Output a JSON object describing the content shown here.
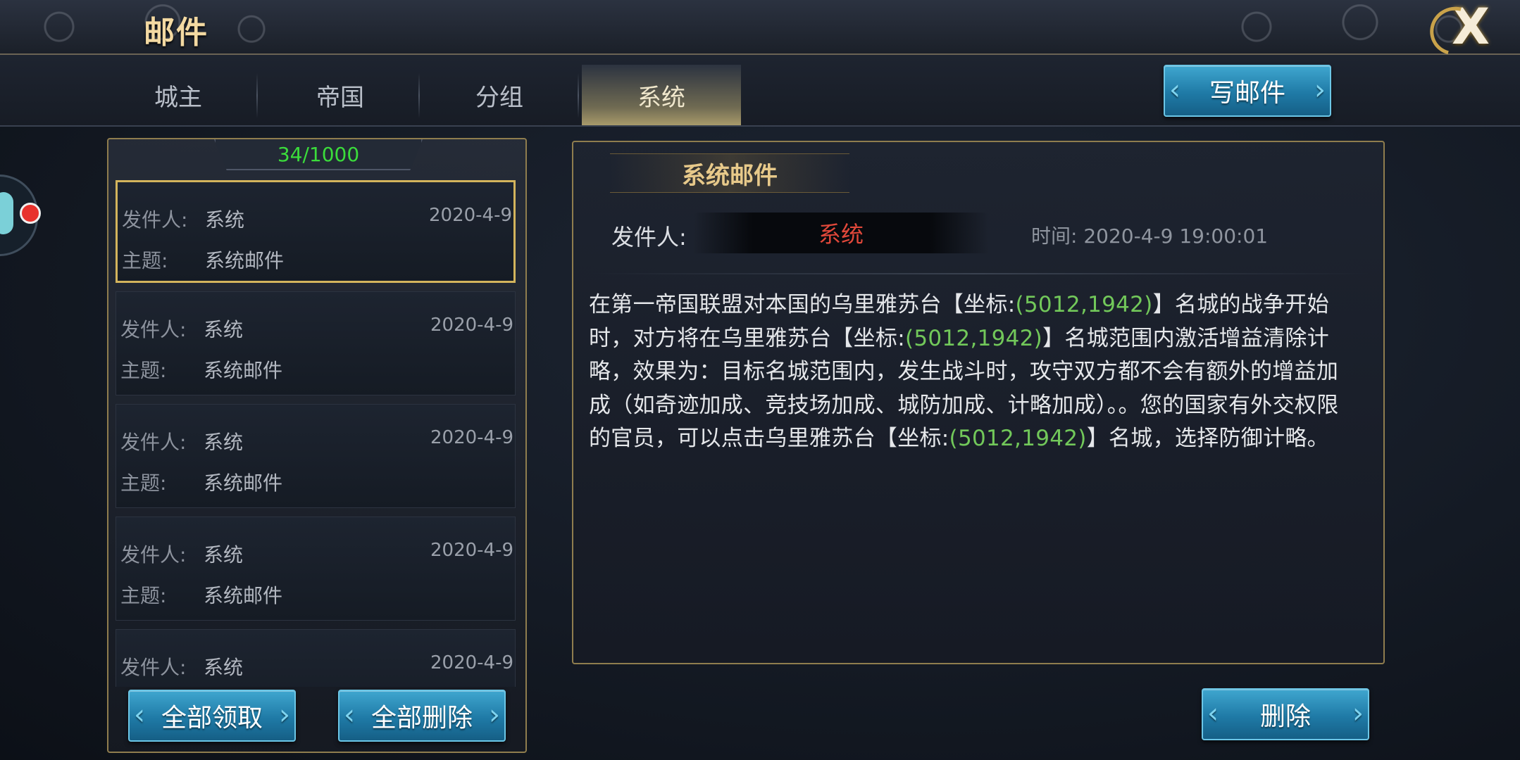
{
  "window": {
    "title": "邮件",
    "close_label": "X"
  },
  "tabs": [
    {
      "label": "城主",
      "active": false
    },
    {
      "label": "帝国",
      "active": false
    },
    {
      "label": "分组",
      "active": false
    },
    {
      "label": "系统",
      "active": true
    }
  ],
  "compose_button": "写邮件",
  "mail_list": {
    "count": "34/1000",
    "sender_label": "发件人:",
    "subject_label": "主题:",
    "items": [
      {
        "sender": "系统",
        "subject": "系统邮件",
        "date": "2020-4-9",
        "selected": true
      },
      {
        "sender": "系统",
        "subject": "系统邮件",
        "date": "2020-4-9",
        "selected": false
      },
      {
        "sender": "系统",
        "subject": "系统邮件",
        "date": "2020-4-9",
        "selected": false
      },
      {
        "sender": "系统",
        "subject": "系统邮件",
        "date": "2020-4-9",
        "selected": false
      },
      {
        "sender": "系统",
        "subject": "",
        "date": "2020-4-9",
        "selected": false
      }
    ],
    "claim_all_button": "全部领取",
    "delete_all_button": "全部删除"
  },
  "mail_detail": {
    "header": "系统邮件",
    "sender_label": "发件人:",
    "sender": "系统",
    "time": "时间: 2020-4-9  19:00:01",
    "body": {
      "t1": "在第一帝国联盟对本国的乌里雅苏台【坐标:",
      "c1": "(5012,1942)",
      "t2": "】名城的战争开始时，对方将在乌里雅苏台【坐标:",
      "c2": "(5012,1942)",
      "t3": "】名城范围内激活增益清除计略，效果为：目标名城范围内，发生战斗时，攻守双方都不会有额外的增益加成（如奇迹加成、竞技场加成、城防加成、计略加成）。。您的国家有外交权限的官员，可以点击乌里雅苏台【坐标:",
      "c3": "(5012,1942)",
      "t4": "】名城，选择防御计略。"
    }
  },
  "delete_button": "删除",
  "colors": {
    "gold_border": "#8f7d4e",
    "selected_border": "#d3b45c",
    "count_green": "#3bdc3b",
    "sender_red": "#e1483a",
    "coord_green": "#72c85a",
    "button_blue": "#1f7aa6"
  },
  "icons": {
    "close": "close-x-icon",
    "side_avatar": "avatar-icon",
    "notification": "red-dot-badge"
  }
}
